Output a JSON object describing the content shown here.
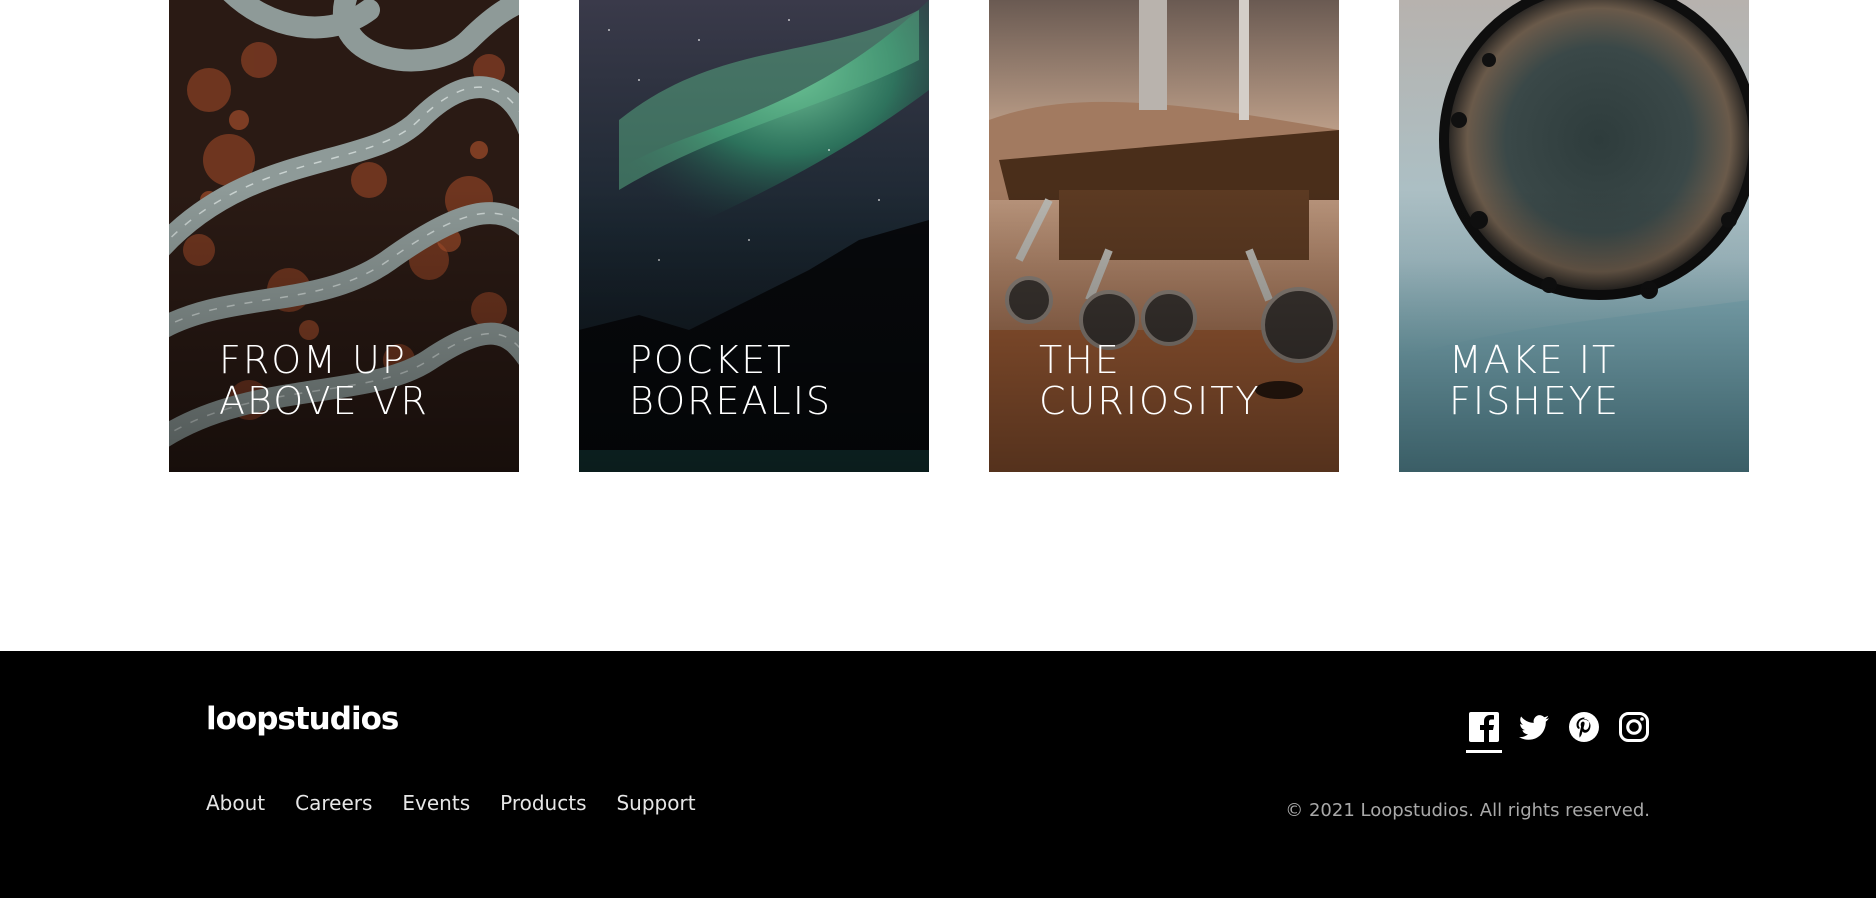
{
  "cards": [
    {
      "title": "FROM UP\nABOVE VR"
    },
    {
      "title": "POCKET\nBOREALIS"
    },
    {
      "title": "THE\nCURIOSITY"
    },
    {
      "title": "MAKE IT\nFISHEYE"
    }
  ],
  "footer": {
    "logo": "loopstudios",
    "nav": [
      "About",
      "Careers",
      "Events",
      "Products",
      "Support"
    ],
    "socials": [
      "facebook-icon",
      "twitter-icon",
      "pinterest-icon",
      "instagram-icon"
    ],
    "copyright": "© 2021 Loopstudios. All rights reserved."
  },
  "colors": {
    "footer_bg": "#000000",
    "text": "#ffffff",
    "muted": "#a9a9a9"
  }
}
